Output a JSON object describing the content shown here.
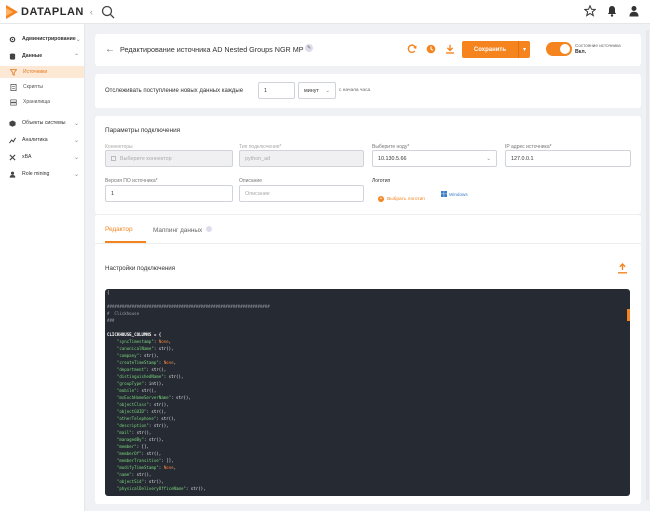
{
  "brand": {
    "name": "DATAPLAN",
    "accent": "#f5841f"
  },
  "sidebar": {
    "items": [
      {
        "label": "Администрирование",
        "icon": "gear-icon",
        "chevron": "⌄"
      },
      {
        "label": "Данные",
        "icon": "database-icon",
        "chevron": "⌃"
      },
      {
        "label": "Объекты системы",
        "icon": "cube-icon",
        "chevron": "⌄"
      },
      {
        "label": "Аналитика",
        "icon": "chart-icon",
        "chevron": "⌄"
      },
      {
        "label": "xBA",
        "icon": "xba-icon",
        "chevron": "⌄"
      },
      {
        "label": "Role mining",
        "icon": "role-icon",
        "chevron": "⌄"
      }
    ],
    "subitems": [
      {
        "label": "Источники",
        "icon": "funnel-icon"
      },
      {
        "label": "Скрипты",
        "icon": "script-icon"
      },
      {
        "label": "Хранилища",
        "icon": "storage-icon"
      }
    ]
  },
  "header": {
    "title": "Редактирование источника AD Nested Groups NGR MP",
    "save_label": "Сохранить",
    "state_label": "Состояние источника",
    "state_value": "Вкл."
  },
  "tracking": {
    "label": "Отслеживать поступление новых данных каждые",
    "interval_value": "1",
    "unit_value": "минут",
    "after_label": "с начала часа"
  },
  "params": {
    "title": "Параметры подключения",
    "connectors_label": "Коннекторы",
    "connectors_placeholder": "Выберите коннектор",
    "conn_type_label": "Тип подключения*",
    "conn_type_value": "python_ad",
    "node_label": "Выберите ноду*",
    "node_value": "10.130.5.66",
    "ip_label": "IP адрес источника*",
    "ip_value": "127.0.0.1",
    "version_label": "Версия ПО источника*",
    "version_value": "1",
    "desc_label": "Описание",
    "desc_placeholder": "Описание",
    "logo_label": "Логотип",
    "logo_choose": "Выбрать логотип",
    "logo_current": "Windows"
  },
  "editor": {
    "tab_editor": "Редактор",
    "tab_mapping": "Маппинг данных",
    "conn_settings_title": "Настройки подключения",
    "code_lines": [
      [
        [
          "s",
          "{"
        ]
      ],
      [
        [
          "s",
          ""
        ]
      ],
      [
        [
          "c",
          "##################################################################"
        ]
      ],
      [
        [
          "c",
          "#  Clickhouse"
        ]
      ],
      [
        [
          "c",
          "###"
        ]
      ],
      [
        [
          "s",
          ""
        ]
      ],
      [
        [
          "w",
          "CLICKHOUSE_COLUMNS = {"
        ]
      ],
      [
        [
          "k",
          "    \"syncTimestamp\""
        ],
        [
          "s",
          ": "
        ],
        [
          "n",
          "None"
        ],
        [
          "s",
          ","
        ]
      ],
      [
        [
          "k",
          "    \"canonicalName\""
        ],
        [
          "s",
          ": str(),"
        ]
      ],
      [
        [
          "k",
          "    \"company\""
        ],
        [
          "s",
          ": str(),"
        ]
      ],
      [
        [
          "k",
          "    \"createTimeStamp\""
        ],
        [
          "s",
          ": "
        ],
        [
          "n",
          "None"
        ],
        [
          "s",
          ","
        ]
      ],
      [
        [
          "k",
          "    \"department\""
        ],
        [
          "s",
          ": str(),"
        ]
      ],
      [
        [
          "k",
          "    \"distinguishedName\""
        ],
        [
          "s",
          ": str(),"
        ]
      ],
      [
        [
          "k",
          "    \"groupType\""
        ],
        [
          "s",
          ": int(),"
        ]
      ],
      [
        [
          "k",
          "    \"mobile\""
        ],
        [
          "s",
          ": str(),"
        ]
      ],
      [
        [
          "k",
          "    \"msExchHomeServerName\""
        ],
        [
          "s",
          ": str(),"
        ]
      ],
      [
        [
          "k",
          "    \"objectClass\""
        ],
        [
          "s",
          ": str(),"
        ]
      ],
      [
        [
          "k",
          "    \"objectGUID\""
        ],
        [
          "s",
          ": str(),"
        ]
      ],
      [
        [
          "k",
          "    \"otherTelephone\""
        ],
        [
          "s",
          ": str(),"
        ]
      ],
      [
        [
          "k",
          "    \"description\""
        ],
        [
          "s",
          ": str(),"
        ]
      ],
      [
        [
          "k",
          "    \"mail\""
        ],
        [
          "s",
          ": str(),"
        ]
      ],
      [
        [
          "k",
          "    \"managedBy\""
        ],
        [
          "s",
          ": str(),"
        ]
      ],
      [
        [
          "k",
          "    \"member\""
        ],
        [
          "s",
          ": [],"
        ]
      ],
      [
        [
          "k",
          "    \"memberOf\""
        ],
        [
          "s",
          ": str(),"
        ]
      ],
      [
        [
          "k",
          "    \"memberTransitive\""
        ],
        [
          "s",
          ": [],"
        ]
      ],
      [
        [
          "k",
          "    \"modifyTimeStamp\""
        ],
        [
          "s",
          ": "
        ],
        [
          "n",
          "None"
        ],
        [
          "s",
          ","
        ]
      ],
      [
        [
          "k",
          "    \"name\""
        ],
        [
          "s",
          ": str(),"
        ]
      ],
      [
        [
          "k",
          "    \"objectSid\""
        ],
        [
          "s",
          ": str(),"
        ]
      ],
      [
        [
          "k",
          "    \"physicalDeliveryOfficeName\""
        ],
        [
          "s",
          ": str(),"
        ]
      ]
    ]
  }
}
